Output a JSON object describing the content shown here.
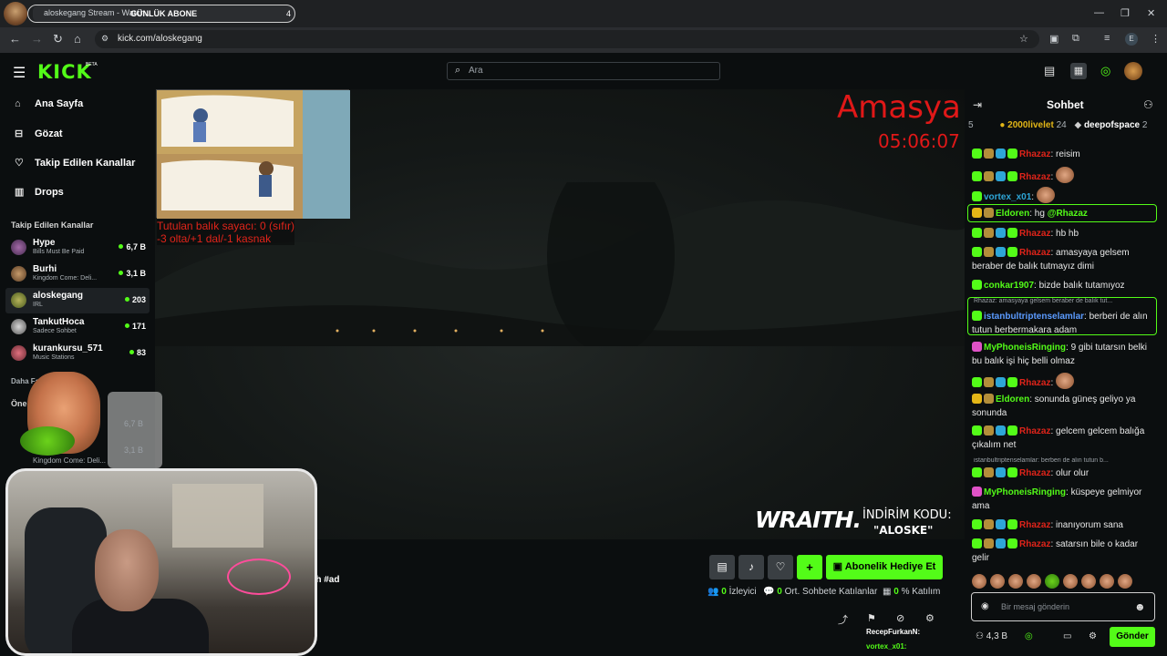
{
  "browser": {
    "tab_title": "aloskegang Stream - Watch...",
    "overlay_label": "GÜNLÜK ABONE",
    "overlay_count": "4",
    "url": "kick.com/aloskegang",
    "profile_initial": "E",
    "minimize": "—",
    "maximize": "❐",
    "close": "✕"
  },
  "header": {
    "logo": "KICK",
    "beta": "BETA",
    "search_placeholder": "Ara"
  },
  "sidebar": {
    "nav": [
      {
        "label": "Ana Sayfa",
        "icon": "⌂"
      },
      {
        "label": "Gözat",
        "icon": "⊟"
      },
      {
        "label": "Takip Edilen Kanallar",
        "icon": "♡"
      },
      {
        "label": "Drops",
        "icon": "▥"
      }
    ],
    "following_heading": "Takip Edilen Kanallar",
    "channels": [
      {
        "name": "Hype",
        "category": "Bills Must Be Paid",
        "viewers": "6,7 B"
      },
      {
        "name": "Burhi",
        "category": "Kingdom Come: Deli...",
        "viewers": "3,1 B"
      },
      {
        "name": "aloskegang",
        "category": "IRL",
        "viewers": "203"
      },
      {
        "name": "TankutHoca",
        "category": "Sadece Sohbet",
        "viewers": "171"
      },
      {
        "name": "kurankursu_571",
        "category": "Music Stations",
        "viewers": "83"
      }
    ],
    "more": "Daha Fazla",
    "recommended_heading": "Öne",
    "overlay_viewers_1": "6,7 B",
    "overlay_viewers_2": "3,1 B",
    "overlay_category": "Kingdom Come: Deli..."
  },
  "video": {
    "fish_counter_line1": "Tutulan balık sayacı: 0 (sıfır)",
    "fish_counter_line2": "-3 olta/+1 dal/-1 kasnak",
    "city": "Amasya",
    "time": "05:06:07",
    "sponsor_brand": "WRAITH.",
    "sponsor_line1": "İNDİRİM KODU:",
    "sponsor_line2": "\"ALOSKE\""
  },
  "stream_info": {
    "hashtag_text": "th #ad",
    "gift_button": "Abonelik Hediye Et",
    "viewers_num": "0",
    "viewers_label": "İzleyici",
    "avg_chat_num": "0",
    "avg_chat_label": "Ort. Sohbete Katılanlar",
    "participation_num": "0",
    "participation_label": "% Katılım",
    "mini_chat_user": "RecepFurkanN:",
    "mini_chat_user2": "vortex_x01:"
  },
  "chat": {
    "title": "Sohbet",
    "leaderboard": [
      {
        "rank": "5",
        "name": "",
        "value": ""
      },
      {
        "rank": "",
        "name": "2000livelet",
        "value": "24"
      },
      {
        "rank": "",
        "name": "deepofspace",
        "value": "2"
      }
    ],
    "messages": [
      {
        "user": "Rhazaz",
        "text": "reisim",
        "color": "#e0241a"
      },
      {
        "user": "Rhazaz",
        "text": "",
        "color": "#e0241a"
      },
      {
        "user": "vortex_x01",
        "text": "",
        "color": "#2ea6d8"
      },
      {
        "user": "Eldoren",
        "text": "hg ",
        "mention": "@Rhazaz",
        "color": "#53fc18"
      },
      {
        "user": "Rhazaz",
        "text": "hb hb",
        "color": "#e0241a"
      },
      {
        "user": "Rhazaz",
        "text": "amasyaya gelsem beraber de balık tutmayız dimi",
        "color": "#e0241a"
      },
      {
        "user": "conkar1907",
        "text": "bizde balık tutamıyoz",
        "color": "#53fc18"
      },
      {
        "reply": "Rhazaz: amasyaya gelsem beraber de balık tut...",
        "user": "istanbultriptenselamlar",
        "text": "berberi de alın tutun berbermakara adam",
        "color": "#5b9bff"
      },
      {
        "user": "MyPhoneisRinging",
        "text": "9 gibi tutarsın belki bu balık işi hiç belli olmaz",
        "color": "#53fc18"
      },
      {
        "user": "Rhazaz",
        "text": "",
        "color": "#e0241a"
      },
      {
        "user": "Eldoren",
        "text": "sonunda güneş geliyo ya sonunda",
        "color": "#53fc18"
      },
      {
        "user": "Rhazaz",
        "text": "gelcem gelcem balığa çıkalım net",
        "color": "#e0241a"
      },
      {
        "reply": "istanbultriptenselamlar: berberi de alın tutun b...",
        "user": "Rhazaz",
        "text": "olur olur",
        "color": "#e0241a"
      },
      {
        "user": "MyPhoneisRinging",
        "text": "küspeye gelmiyor ama",
        "color": "#53fc18"
      },
      {
        "user": "Rhazaz",
        "text": "inanıyorum sana",
        "color": "#e0241a"
      },
      {
        "user": "Rhazaz",
        "text": "satarsın bile o kadar gelir",
        "color": "#e0241a"
      }
    ],
    "input_placeholder": "Bir mesaj gönderin",
    "balance": "4,3 B",
    "send": "Gönder"
  }
}
